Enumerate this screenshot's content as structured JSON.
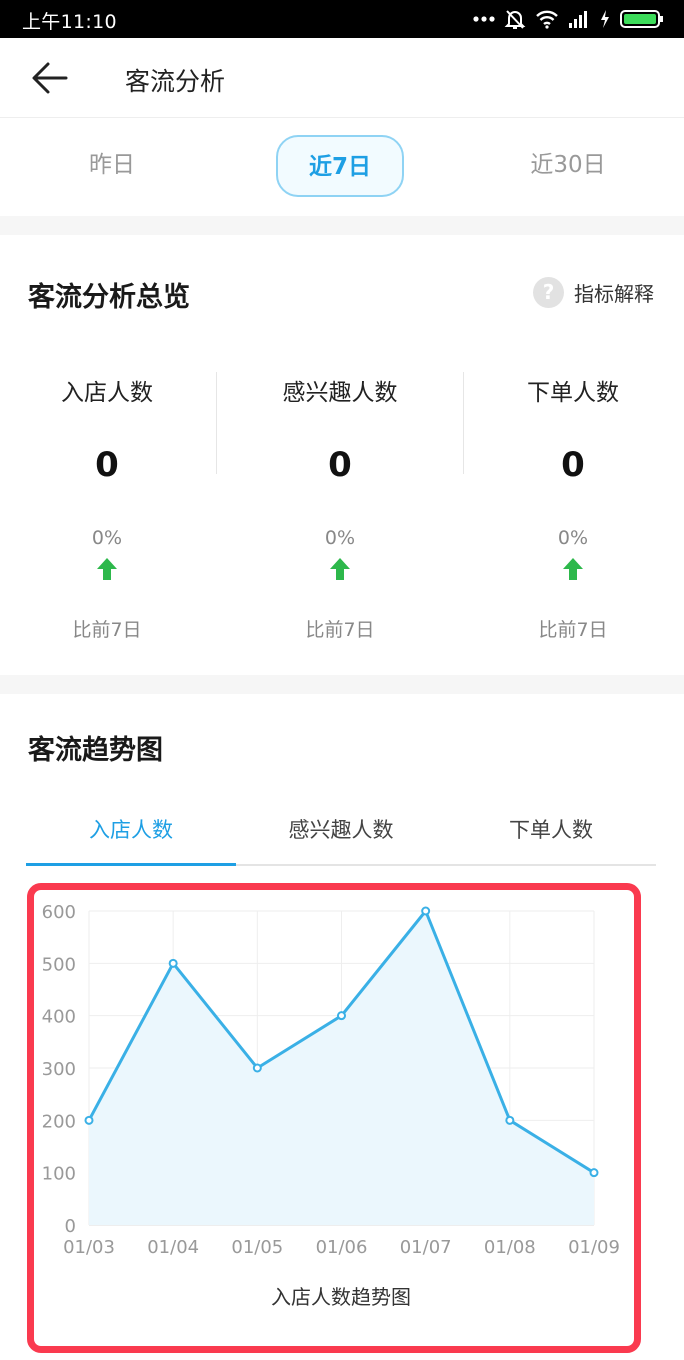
{
  "status_bar": {
    "time": "上午11:10",
    "icons": [
      "more-dots-icon",
      "alarm-off-icon",
      "wifi-icon",
      "signal-icon",
      "charging-icon",
      "battery-icon"
    ]
  },
  "header": {
    "title": "客流分析"
  },
  "range_tabs": [
    {
      "label": "昨日",
      "active": false
    },
    {
      "label": "近7日",
      "active": true
    },
    {
      "label": "近30日",
      "active": false
    }
  ],
  "overview": {
    "title": "客流分析总览",
    "help_label": "指标解释",
    "metrics": [
      {
        "label": "入店人数",
        "value": "0",
        "change": "0%",
        "compare": "比前7日"
      },
      {
        "label": "感兴趣人数",
        "value": "0",
        "change": "0%",
        "compare": "比前7日"
      },
      {
        "label": "下单人数",
        "value": "0",
        "change": "0%",
        "compare": "比前7日"
      }
    ]
  },
  "trend": {
    "title": "客流趋势图",
    "tabs": [
      {
        "label": "入店人数",
        "active": true
      },
      {
        "label": "感兴趣人数",
        "active": false
      },
      {
        "label": "下单人数",
        "active": false
      }
    ]
  },
  "colors": {
    "accent": "#1e9fe4",
    "up_arrow": "#2db84b",
    "line": "#3ab0e6",
    "area": "#ebf7fd",
    "highlight_border": "#fa3a4f"
  },
  "chart_data": {
    "type": "area",
    "x": [
      "01/03",
      "01/04",
      "01/05",
      "01/06",
      "01/07",
      "01/08",
      "01/09"
    ],
    "values": [
      200,
      500,
      300,
      400,
      600,
      200,
      100
    ],
    "yticks": [
      0,
      100,
      200,
      300,
      400,
      500,
      600
    ],
    "ylim": [
      0,
      600
    ],
    "title": "入店人数趋势图",
    "grid": true
  }
}
